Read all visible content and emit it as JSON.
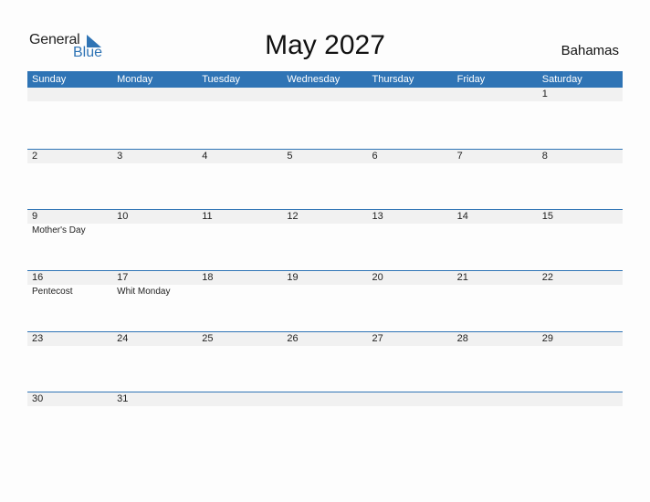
{
  "logo": {
    "text_general": "General",
    "text_blue": "Blue"
  },
  "title": "May 2027",
  "country": "Bahamas",
  "colors": {
    "accent": "#2f74b5",
    "date_strip": "#f1f1f1"
  },
  "weekdays": [
    "Sunday",
    "Monday",
    "Tuesday",
    "Wednesday",
    "Thursday",
    "Friday",
    "Saturday"
  ],
  "weeks": [
    {
      "days": [
        "",
        "",
        "",
        "",
        "",
        "",
        "1"
      ],
      "events": [
        "",
        "",
        "",
        "",
        "",
        "",
        ""
      ]
    },
    {
      "days": [
        "2",
        "3",
        "4",
        "5",
        "6",
        "7",
        "8"
      ],
      "events": [
        "",
        "",
        "",
        "",
        "",
        "",
        ""
      ]
    },
    {
      "days": [
        "9",
        "10",
        "11",
        "12",
        "13",
        "14",
        "15"
      ],
      "events": [
        "Mother's Day",
        "",
        "",
        "",
        "",
        "",
        ""
      ]
    },
    {
      "days": [
        "16",
        "17",
        "18",
        "19",
        "20",
        "21",
        "22"
      ],
      "events": [
        "Pentecost",
        "Whit Monday",
        "",
        "",
        "",
        "",
        ""
      ]
    },
    {
      "days": [
        "23",
        "24",
        "25",
        "26",
        "27",
        "28",
        "29"
      ],
      "events": [
        "",
        "",
        "",
        "",
        "",
        "",
        ""
      ]
    },
    {
      "days": [
        "30",
        "31",
        "",
        "",
        "",
        "",
        ""
      ],
      "events": [
        "",
        "",
        "",
        "",
        "",
        "",
        ""
      ]
    }
  ]
}
